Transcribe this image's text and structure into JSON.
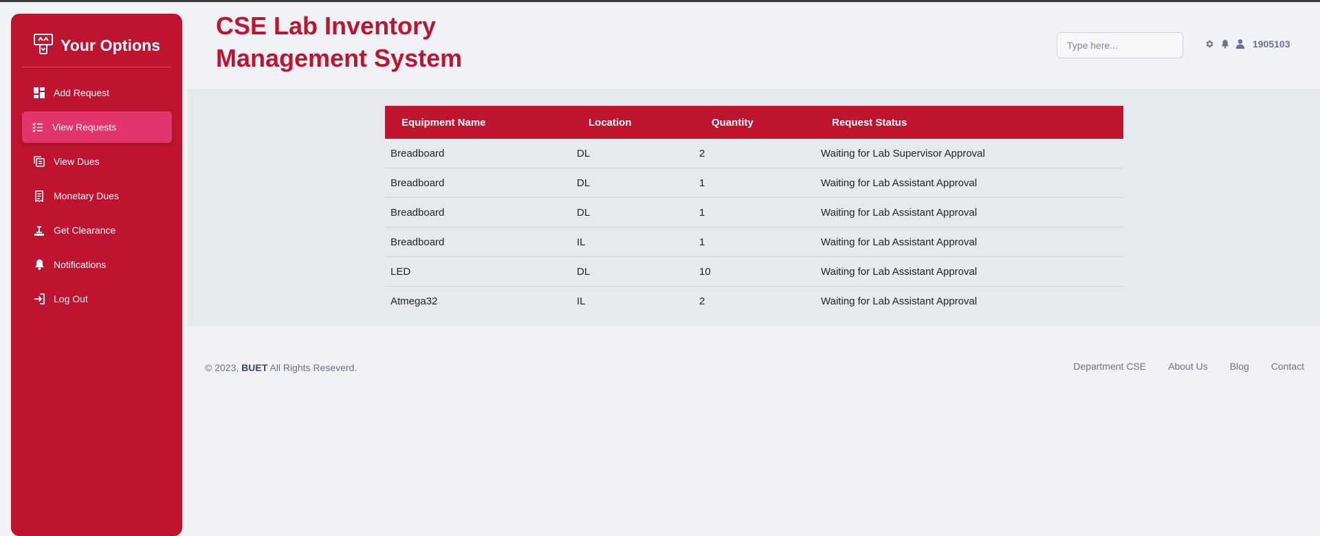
{
  "sidebar": {
    "brand": "Your Options",
    "items": [
      {
        "label": "Add Request",
        "icon": "dashboard-icon",
        "active": false
      },
      {
        "label": "View Requests",
        "icon": "list-check-icon",
        "active": true
      },
      {
        "label": "View Dues",
        "icon": "stacked-docs-icon",
        "active": false
      },
      {
        "label": "Monetary Dues",
        "icon": "receipt-icon",
        "active": false
      },
      {
        "label": "Get Clearance",
        "icon": "stamp-icon",
        "active": false
      },
      {
        "label": "Notifications",
        "icon": "bell-icon",
        "active": false
      },
      {
        "label": "Log Out",
        "icon": "logout-icon",
        "active": false
      }
    ]
  },
  "header": {
    "title": "CSE Lab Inventory Management System",
    "search_placeholder": "Type here...",
    "user_id": "1905103"
  },
  "table": {
    "columns": [
      "Equipment Name",
      "Location",
      "Quantity",
      "Request Status"
    ],
    "rows": [
      [
        "Breadboard",
        "DL",
        "2",
        "Waiting for Lab Supervisor Approval"
      ],
      [
        "Breadboard",
        "DL",
        "1",
        "Waiting for Lab Assistant Approval"
      ],
      [
        "Breadboard",
        "DL",
        "1",
        "Waiting for Lab Assistant Approval"
      ],
      [
        "Breadboard",
        "IL",
        "1",
        "Waiting for Lab Assistant Approval"
      ],
      [
        "LED",
        "DL",
        "10",
        "Waiting for Lab Assistant Approval"
      ],
      [
        "Atmega32",
        "IL",
        "2",
        "Waiting for Lab Assistant Approval"
      ]
    ]
  },
  "footer": {
    "copyright_prefix": "© 2023,",
    "org": "BUET",
    "copyright_suffix": "All Rights Reseverd.",
    "links": [
      "Department CSE",
      "About Us",
      "Blog",
      "Contact"
    ]
  },
  "colors": {
    "brand": "#bf142f",
    "active_item": "#e3356d",
    "muted_text": "#67748e"
  }
}
